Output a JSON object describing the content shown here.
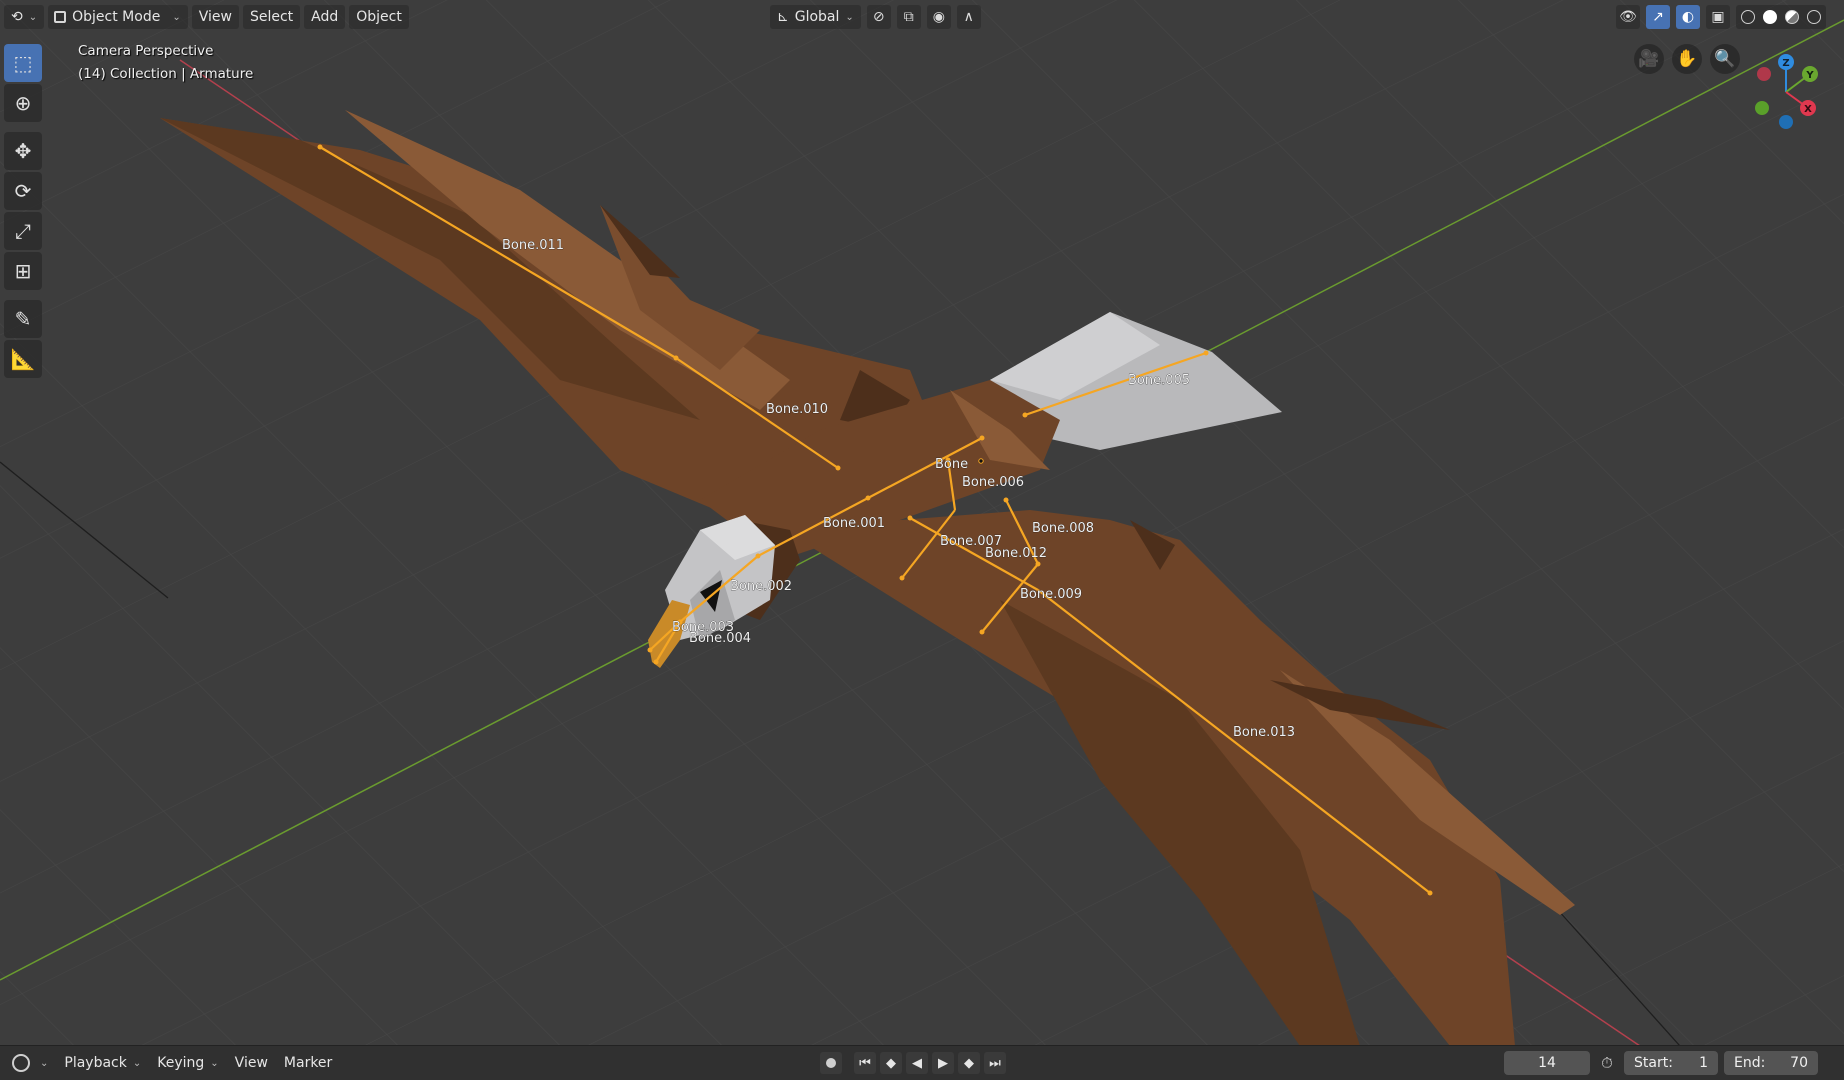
{
  "header": {
    "editor_type_icon": "viewport-editor-icon",
    "mode_label": "Object Mode",
    "menus": [
      "View",
      "Select",
      "Add",
      "Object"
    ],
    "transform_orientation": "Global",
    "icons": [
      "orientation-axes-icon",
      "pivot-icon",
      "snap-icon",
      "proportional-edit-icon",
      "visibility-icon",
      "gizmo-icon",
      "overlay-icon",
      "xray-icon"
    ],
    "shading_modes": [
      "wireframe",
      "solid",
      "material-preview",
      "rendered"
    ],
    "active_shading": "solid"
  },
  "toolbar": {
    "tools": [
      {
        "name": "select-box",
        "icon": "select-box-icon",
        "active": true
      },
      {
        "name": "cursor",
        "icon": "cursor-icon",
        "active": false
      },
      {
        "name": "move",
        "icon": "move-icon",
        "active": false
      },
      {
        "name": "rotate",
        "icon": "rotate-icon",
        "active": false
      },
      {
        "name": "scale",
        "icon": "scale-icon",
        "active": false
      },
      {
        "name": "transform",
        "icon": "transform-icon",
        "active": false
      },
      {
        "name": "annotate",
        "icon": "annotate-icon",
        "active": false
      },
      {
        "name": "measure",
        "icon": "measure-icon",
        "active": false
      }
    ]
  },
  "viewport": {
    "view_name": "Camera Perspective",
    "collection_info": "(14) Collection | Armature",
    "bones": [
      "Bone.011",
      "Bone.010",
      "Bone.005",
      "Bone",
      "Bone.006",
      "Bone.001",
      "Bone.008",
      "Bone.007",
      "Bone.012",
      "Bone.002",
      "Bone.009",
      "Bone.003",
      "Bone.004",
      "Bone.013"
    ],
    "colors": {
      "background": "#3d3d3d",
      "grid": "#474747",
      "x_axis": "#b3404d",
      "y_axis": "#6a9b2f",
      "bone": "#f5a623",
      "body": "#6e4428",
      "body_light": "#8a5a37",
      "body_dark": "#4d2f1b",
      "tail": "#b9b9bb",
      "head": "#c4c4c6",
      "beak": "#c98a28"
    }
  },
  "gizmo": {
    "axes": [
      {
        "label": "Z",
        "color": "#2f8ce0"
      },
      {
        "label": "Y",
        "color": "#6aa82f"
      },
      {
        "label": "X",
        "color": "#e0384f"
      }
    ]
  },
  "nav_buttons": [
    "camera-view-icon",
    "pan-hand-icon",
    "zoom-icon"
  ],
  "timeline": {
    "menus": [
      "Playback",
      "Keying",
      "View",
      "Marker"
    ],
    "current_frame": "14",
    "start_label": "Start:",
    "start_value": "1",
    "end_label": "End:",
    "end_value": "70"
  }
}
